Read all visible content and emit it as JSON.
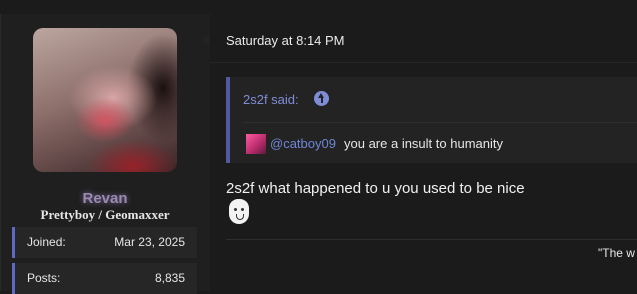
{
  "profile": {
    "username": "Revan",
    "user_title": "Prettyboy / Geomaxxer",
    "stats": [
      {
        "label": "Joined:",
        "value": "Mar 23, 2025"
      },
      {
        "label": "Posts:",
        "value": "8,835"
      }
    ]
  },
  "post": {
    "timestamp": "Saturday at 8:14 PM",
    "quote": {
      "author_said": "2s2f said:",
      "mention": "@catboy09",
      "text": "you are a insult to humanity"
    },
    "message": "2s2f what happened to u you used to be nice",
    "emoji": "crying-face-emoji",
    "signature_fragment": "\"The w"
  },
  "colors": {
    "accent": "#5b6bc4",
    "link": "#7f8dd6",
    "background": "#1b1b1b"
  }
}
